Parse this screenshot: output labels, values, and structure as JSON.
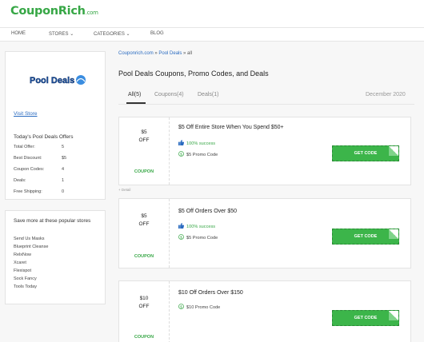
{
  "logo": {
    "brand_main": "Coupon",
    "brand_accent": "Rich",
    "domain": ".com"
  },
  "nav": {
    "home": "HOME",
    "stores": "STORES ⌄",
    "categories": "CATEGORIES ⌄",
    "blog": "BLOG"
  },
  "sidebar": {
    "store_logo_text": "Pool Deals",
    "visit_store": "Visit Store",
    "offers_title": "Today's Pool Deals Offers",
    "stats": [
      {
        "label": "Total Offer:",
        "value": "5"
      },
      {
        "label": "Best Discount:",
        "value": "$5"
      },
      {
        "label": "Coupon Codes:",
        "value": "4"
      },
      {
        "label": "Deals:",
        "value": "1"
      },
      {
        "label": "Free Shipping:",
        "value": "0"
      }
    ],
    "popular_title": "Save more at these popular stores",
    "popular_stores": [
      "Send Us Masks",
      "Blueprint Cleanse",
      "RelxNow",
      "Xcaret",
      "Flexispot",
      "Sock Fancy",
      "Tools Today"
    ]
  },
  "breadcrumb": {
    "home": "Couponrich.com",
    "sep1": " » ",
    "store": "Pool Deals",
    "sep2": " » ",
    "current": "all"
  },
  "page_title": "Pool Deals Coupons, Promo Codes, and Deals",
  "tabs": [
    {
      "label": "All(5)"
    },
    {
      "label": "Coupons(4)"
    },
    {
      "label": "Deals(1)"
    }
  ],
  "date": "December 2020",
  "coupons": [
    {
      "amount": "$5",
      "unit": "OFF",
      "type": "COUPON",
      "title": "$5 Off Entire Store When You Spend $50+",
      "success": "100% success",
      "promo": "$5 Promo Code",
      "button": "GET CODE"
    },
    {
      "amount": "$5",
      "unit": "OFF",
      "type": "COUPON",
      "title": "$5 Off Orders Over $50",
      "success": "100% success",
      "promo": "$5 Promo Code",
      "button": "GET CODE"
    },
    {
      "amount": "$10",
      "unit": "OFF",
      "type": "COUPON",
      "title": "$10 Off Orders Over $150",
      "promo": "$10 Promo Code",
      "button": "GET CODE"
    }
  ],
  "detail_link": "+ Detail",
  "colors": {
    "brand_green": "#37a746",
    "button_green": "#3cb54a",
    "link_blue": "#2a6bc0"
  }
}
